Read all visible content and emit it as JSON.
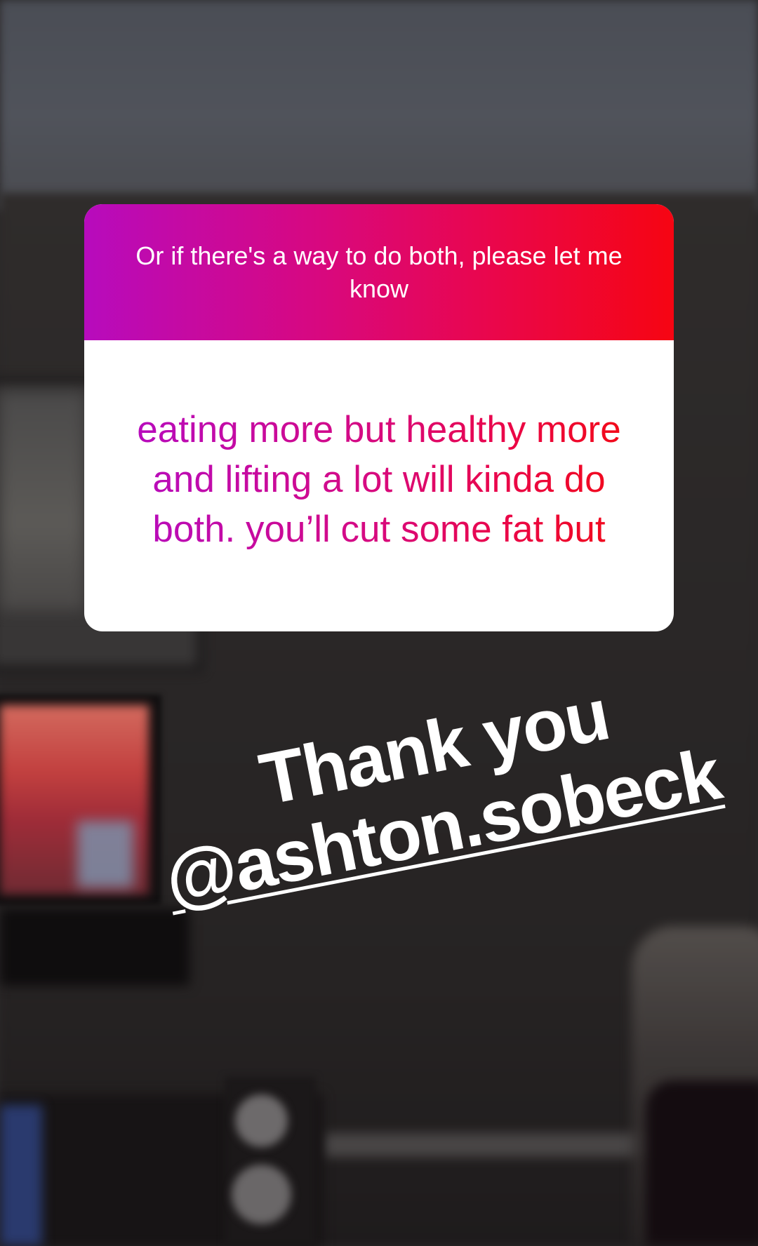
{
  "story": {
    "question_sticker": {
      "question": "Or if there's a way to do both, please let me know",
      "answer": "eating more but healthy more and lifting a lot will kinda do both. you’ll cut some fat but",
      "gradient_colors": [
        "#b70bbd",
        "#f60512"
      ]
    },
    "caption": {
      "line1": "Thank you",
      "mention": "@ashton.sobeck"
    }
  }
}
